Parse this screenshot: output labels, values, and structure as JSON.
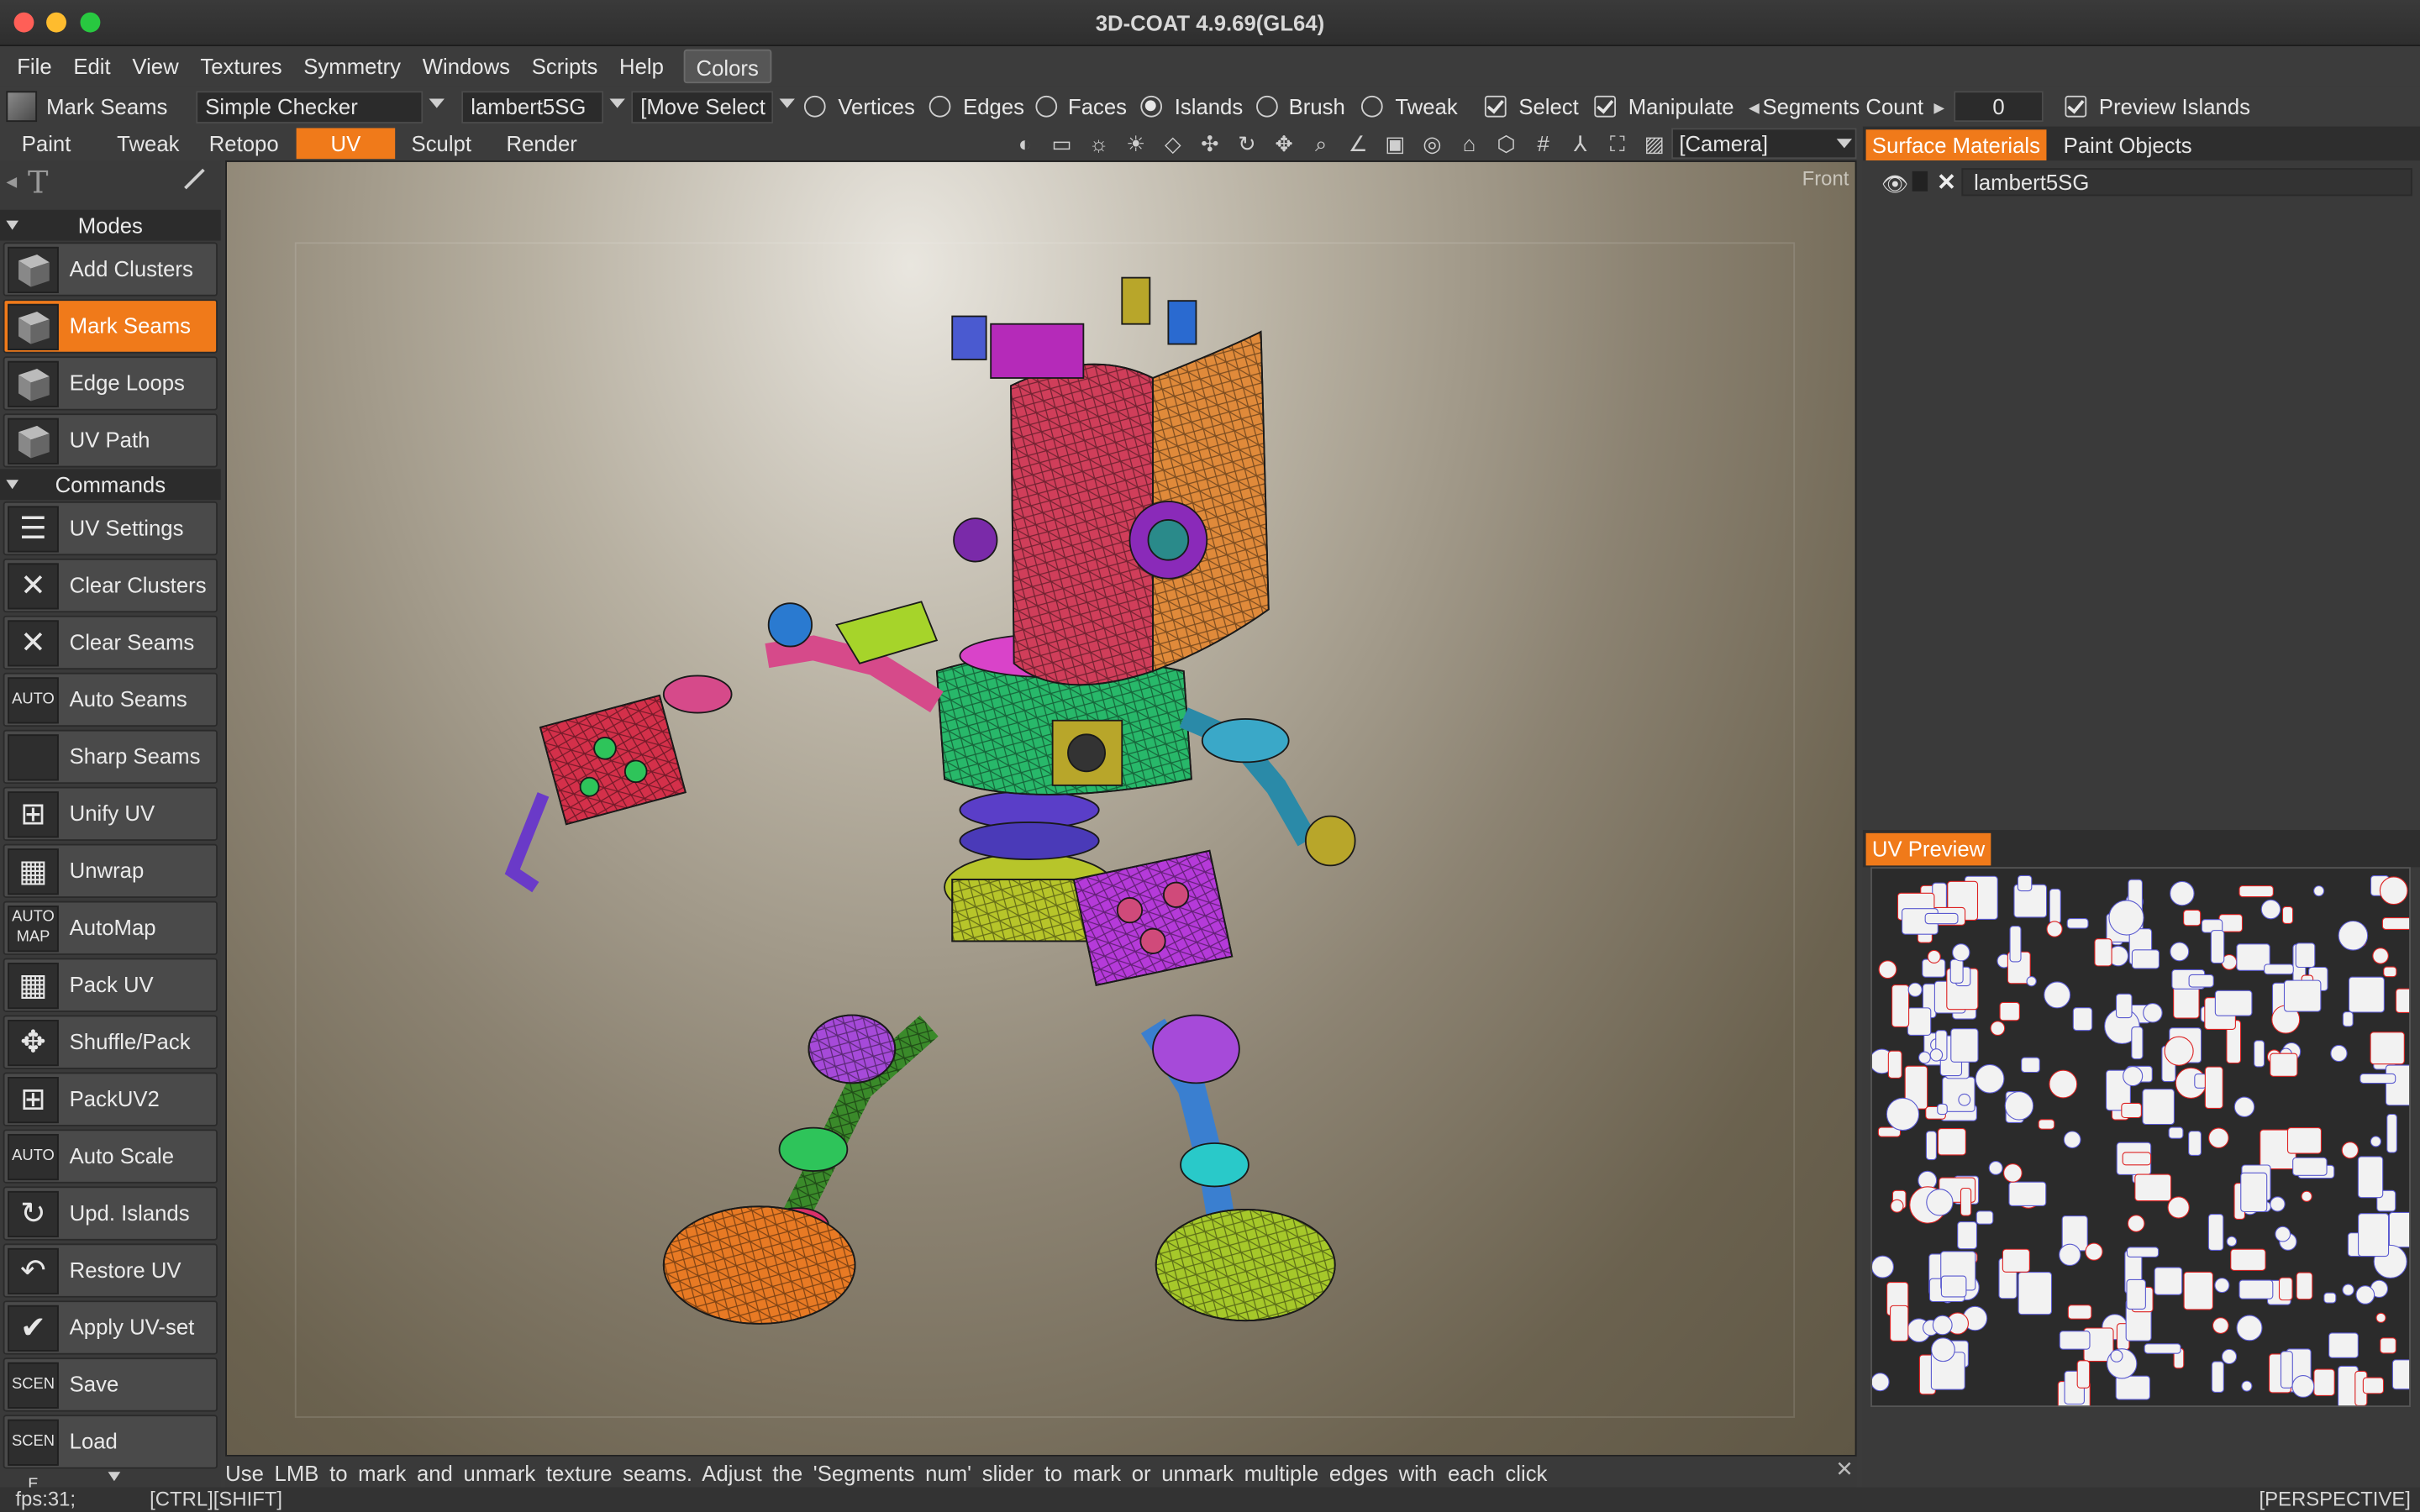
{
  "app": {
    "title": "3D-COAT 4.9.69(GL64)"
  },
  "menu": [
    "File",
    "Edit",
    "View",
    "Textures",
    "Symmetry",
    "Windows",
    "Scripts",
    "Help",
    "Colors"
  ],
  "toolbar1": {
    "mode_label": "Mark Seams",
    "shader": "Simple Checker",
    "material": "lambert5SG",
    "move_select": "[Move  Select",
    "radios": [
      "Vertices",
      "Edges",
      "Faces",
      "Islands",
      "Brush",
      "Tweak"
    ],
    "selected_radio": "Islands",
    "checks": [
      "Select",
      "Manipulate"
    ],
    "segments_label": "Segments  Count",
    "segments_value": "0",
    "preview_islands": "Preview  Islands"
  },
  "rooms": [
    "Paint",
    "Tweak",
    "Retopo",
    "UV",
    "Sculpt",
    "Render"
  ],
  "active_room": "UV",
  "camera": "[Camera]",
  "left_panel": {
    "modes_header": "Modes",
    "modes": [
      {
        "label": "Add  Clusters",
        "icon": "cube-icon"
      },
      {
        "label": "Mark  Seams",
        "icon": "cube-icon"
      },
      {
        "label": "Edge  Loops",
        "icon": "cube-icon"
      },
      {
        "label": "UV  Path",
        "icon": "cube-icon"
      }
    ],
    "commands_header": "Commands",
    "commands": [
      {
        "label": "UV  Settings",
        "icon": "sliders-icon",
        "glyph": "☰"
      },
      {
        "label": "Clear  Clusters",
        "icon": "clear-icon",
        "glyph": "✕"
      },
      {
        "label": "Clear  Seams",
        "icon": "clear-icon",
        "glyph": "✕"
      },
      {
        "label": "Auto  Seams",
        "icon": "auto-icon",
        "glyph": "AUTO"
      },
      {
        "label": "Sharp  Seams",
        "icon": "cube-icon",
        "glyph": ""
      },
      {
        "label": "Unify  UV",
        "icon": "unify-icon",
        "glyph": "⊞"
      },
      {
        "label": "Unwrap",
        "icon": "grid-icon",
        "glyph": "▦"
      },
      {
        "label": "AutoMap",
        "icon": "automap-icon",
        "glyph": "AUTO MAP"
      },
      {
        "label": "Pack  UV",
        "icon": "pack-icon",
        "glyph": "▦"
      },
      {
        "label": "Shuffle/Pack",
        "icon": "shuffle-icon",
        "glyph": "✥"
      },
      {
        "label": "PackUV2",
        "icon": "pack2-icon",
        "glyph": "⊞"
      },
      {
        "label": "Auto  Scale",
        "icon": "auto-scale-icon",
        "glyph": "AUTO"
      },
      {
        "label": "Upd.  Islands",
        "icon": "refresh-icon",
        "glyph": "↻"
      },
      {
        "label": "Restore  UV",
        "icon": "restore-icon",
        "glyph": "↶"
      },
      {
        "label": "Apply  UV-set",
        "icon": "check-icon",
        "glyph": "✔"
      },
      {
        "label": "Save",
        "icon": "scene-save-icon",
        "glyph": "SCENE"
      },
      {
        "label": "Load",
        "icon": "scene-load-icon",
        "glyph": "SCENE"
      }
    ]
  },
  "viewport": {
    "view_label": "Front"
  },
  "status": {
    "hint": "Use LMB to mark and unmark texture seams. Adjust the 'Segments num' slider to mark or unmark multiple edges with each click",
    "fps": "fps:31;",
    "modifiers": "[CTRL][SHIFT]",
    "projection": "[PERSPECTIVE]"
  },
  "right_panel": {
    "tabs": [
      "Surface  Materials",
      "Paint  Objects"
    ],
    "material_row": "lambert5SG",
    "uv_preview_tab": "UV  Preview"
  },
  "colors": {
    "accent": "#f07a1a"
  }
}
